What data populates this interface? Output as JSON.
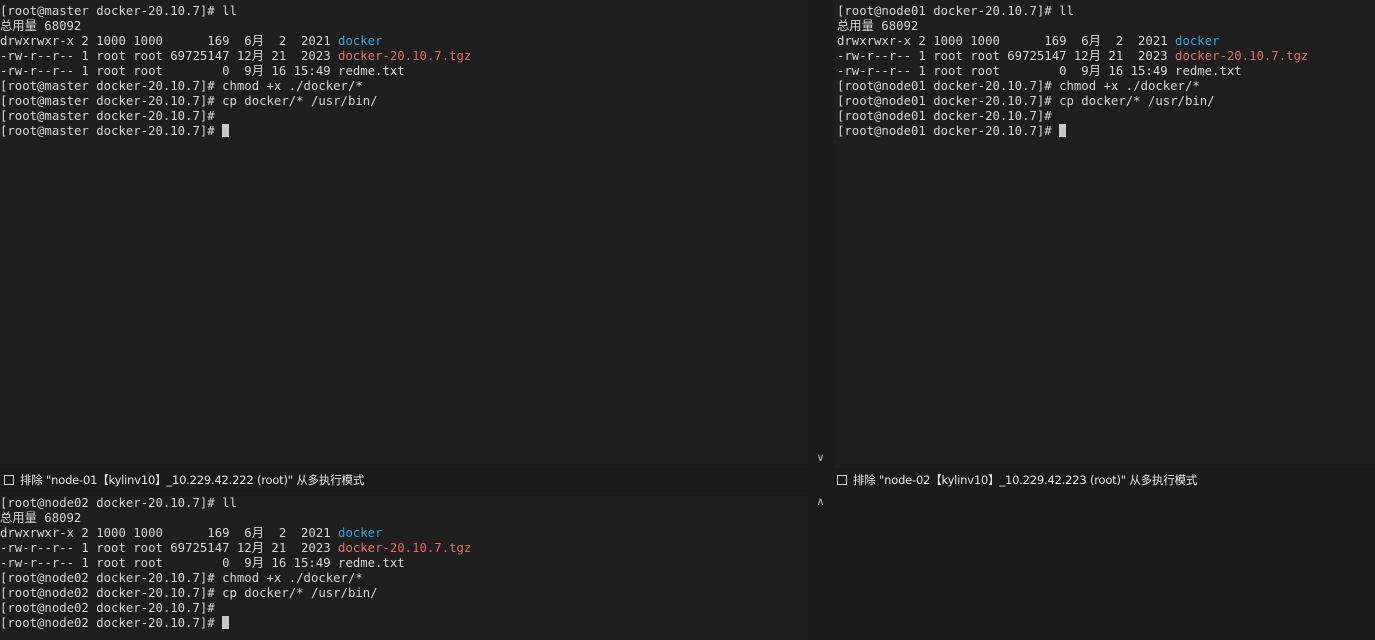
{
  "panes": {
    "master": {
      "lines": [
        {
          "text": "[root@master docker-20.10.7]# ll"
        },
        {
          "text": "总用量 68092"
        },
        {
          "prefix": "drwxrwxr-x 2 1000 1000      169  6月  2  2021 ",
          "name": "docker",
          "kind": "dir"
        },
        {
          "prefix": "-rw-r--r-- 1 root root 69725147 12月 21  2023 ",
          "name": "docker-20.10.7.tgz",
          "kind": "arc"
        },
        {
          "text": "-rw-r--r-- 1 root root        0  9月 16 15:49 redme.txt"
        },
        {
          "text": "[root@master docker-20.10.7]# chmod +x ./docker/*"
        },
        {
          "text": "[root@master docker-20.10.7]# cp docker/* /usr/bin/"
        },
        {
          "text": "[root@master docker-20.10.7]#"
        },
        {
          "text": "[root@master docker-20.10.7]# ",
          "cursor": true
        }
      ]
    },
    "node01": {
      "lines": [
        {
          "text": "[root@node01 docker-20.10.7]# ll"
        },
        {
          "text": "总用量 68092"
        },
        {
          "prefix": "drwxrwxr-x 2 1000 1000      169  6月  2  2021 ",
          "name": "docker",
          "kind": "dir"
        },
        {
          "prefix": "-rw-r--r-- 1 root root 69725147 12月 21  2023 ",
          "name": "docker-20.10.7.tgz",
          "kind": "arc"
        },
        {
          "text": "-rw-r--r-- 1 root root        0  9月 16 15:49 redme.txt"
        },
        {
          "text": "[root@node01 docker-20.10.7]# chmod +x ./docker/*"
        },
        {
          "text": "[root@node01 docker-20.10.7]# cp docker/* /usr/bin/"
        },
        {
          "text": "[root@node01 docker-20.10.7]#"
        },
        {
          "text": "[root@node01 docker-20.10.7]# ",
          "cursor": true
        }
      ]
    },
    "node02": {
      "lines": [
        {
          "text": "[root@node02 docker-20.10.7]# ll"
        },
        {
          "text": "总用量 68092"
        },
        {
          "prefix": "drwxrwxr-x 2 1000 1000      169  6月  2  2021 ",
          "name": "docker",
          "kind": "dir"
        },
        {
          "prefix": "-rw-r--r-- 1 root root 69725147 12月 21  2023 ",
          "name": "docker-20.10.7.tgz",
          "kind": "arc"
        },
        {
          "text": "-rw-r--r-- 1 root root        0  9月 16 15:49 redme.txt"
        },
        {
          "text": "[root@node02 docker-20.10.7]# chmod +x ./docker/*"
        },
        {
          "text": "[root@node02 docker-20.10.7]# cp docker/* /usr/bin/"
        },
        {
          "text": "[root@node02 docker-20.10.7]#"
        },
        {
          "text": "[root@node02 docker-20.10.7]# ",
          "cursor": true
        }
      ]
    }
  },
  "status": {
    "left_label": "排除 \"node-01【kylinv10】_10.229.42.222 (root)\" 从多执行模式",
    "right_label": "排除 \"node-02【kylinv10】_10.229.42.223 (root)\" 从多执行模式"
  },
  "icons": {
    "scroll_down": "∨",
    "scroll_up": "∧"
  },
  "colors": {
    "background": "#1e1e1e",
    "text": "#d4d4d4",
    "directory": "#3aa0dc",
    "archive": "#e06c6c"
  }
}
